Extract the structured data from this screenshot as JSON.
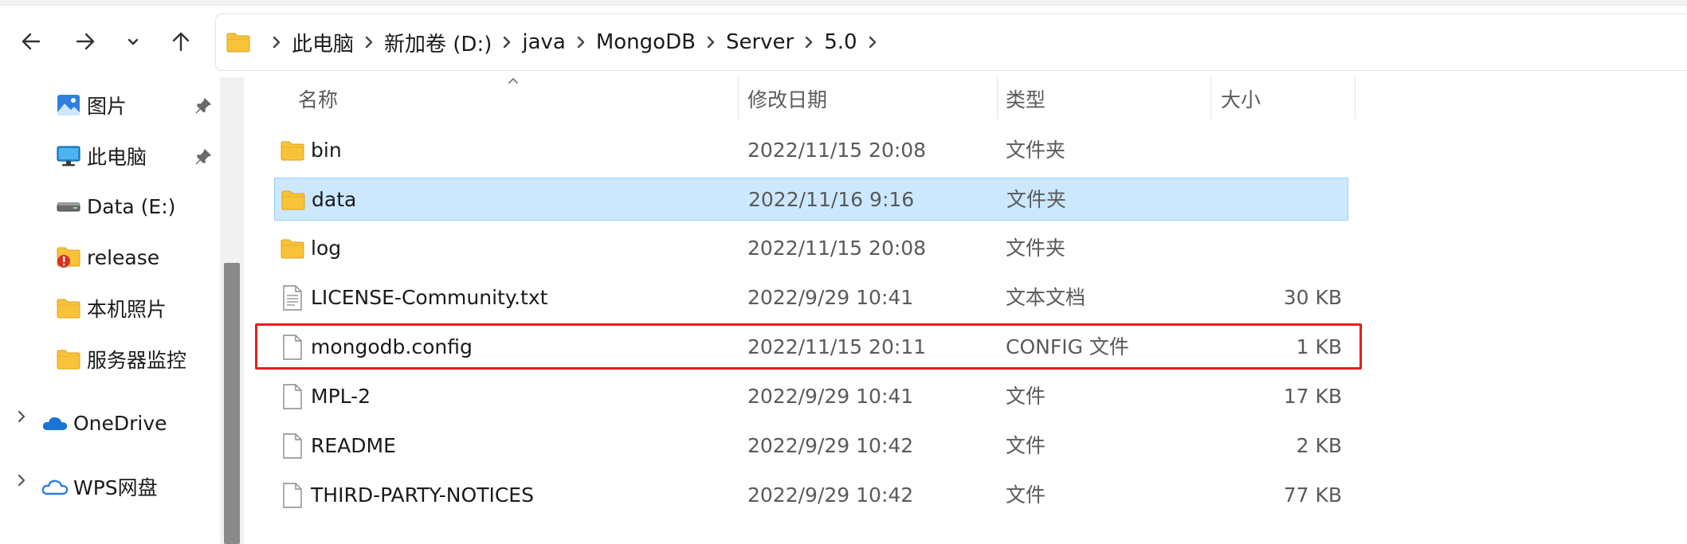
{
  "nav": {
    "back_icon": "back-arrow-icon",
    "forward_icon": "forward-arrow-icon",
    "recent_icon": "chevron-down-icon",
    "up_icon": "up-arrow-icon"
  },
  "address": {
    "crumbs": [
      "此电脑",
      "新加卷 (D:)",
      "java",
      "MongoDB",
      "Server",
      "5.0"
    ]
  },
  "sidebar": {
    "items": [
      {
        "label": "图片",
        "icon": "pictures-icon",
        "pinned": true
      },
      {
        "label": "此电脑",
        "icon": "this-pc-icon",
        "pinned": true
      },
      {
        "label": "Data (E:)",
        "icon": "drive-icon",
        "pinned": false
      },
      {
        "label": "release",
        "icon": "folder-warning-icon",
        "pinned": false
      },
      {
        "label": "本机照片",
        "icon": "folder-icon",
        "pinned": false
      },
      {
        "label": "服务器监控",
        "icon": "folder-icon",
        "pinned": false
      },
      {
        "label": "OneDrive",
        "icon": "onedrive-icon",
        "pinned": false
      },
      {
        "label": "WPS网盘",
        "icon": "wps-cloud-icon",
        "pinned": false
      }
    ]
  },
  "columns": {
    "name": "名称",
    "modified": "修改日期",
    "type": "类型",
    "size": "大小"
  },
  "files": [
    {
      "name": "bin",
      "modified": "2022/11/15 20:08",
      "type": "文件夹",
      "size": "",
      "icon": "folder-icon"
    },
    {
      "name": "data",
      "modified": "2022/11/16 9:16",
      "type": "文件夹",
      "size": "",
      "icon": "folder-icon",
      "selected": true
    },
    {
      "name": "log",
      "modified": "2022/11/15 20:08",
      "type": "文件夹",
      "size": "",
      "icon": "folder-icon"
    },
    {
      "name": "LICENSE-Community.txt",
      "modified": "2022/9/29 10:41",
      "type": "文本文档",
      "size": "30 KB",
      "icon": "text-file-icon"
    },
    {
      "name": "mongodb.config",
      "modified": "2022/11/15 20:11",
      "type": "CONFIG 文件",
      "size": "1 KB",
      "icon": "file-icon",
      "highlighted": true
    },
    {
      "name": "MPL-2",
      "modified": "2022/9/29 10:41",
      "type": "文件",
      "size": "17 KB",
      "icon": "file-icon"
    },
    {
      "name": "README",
      "modified": "2022/9/29 10:42",
      "type": "文件",
      "size": "2 KB",
      "icon": "file-icon"
    },
    {
      "name": "THIRD-PARTY-NOTICES",
      "modified": "2022/9/29 10:42",
      "type": "文件",
      "size": "77 KB",
      "icon": "file-icon"
    }
  ],
  "colors": {
    "selection_bg": "#cce8ff",
    "selection_border": "#99d1ff",
    "highlight_border": "#e02020",
    "folder_yellow": "#f8c33a"
  }
}
